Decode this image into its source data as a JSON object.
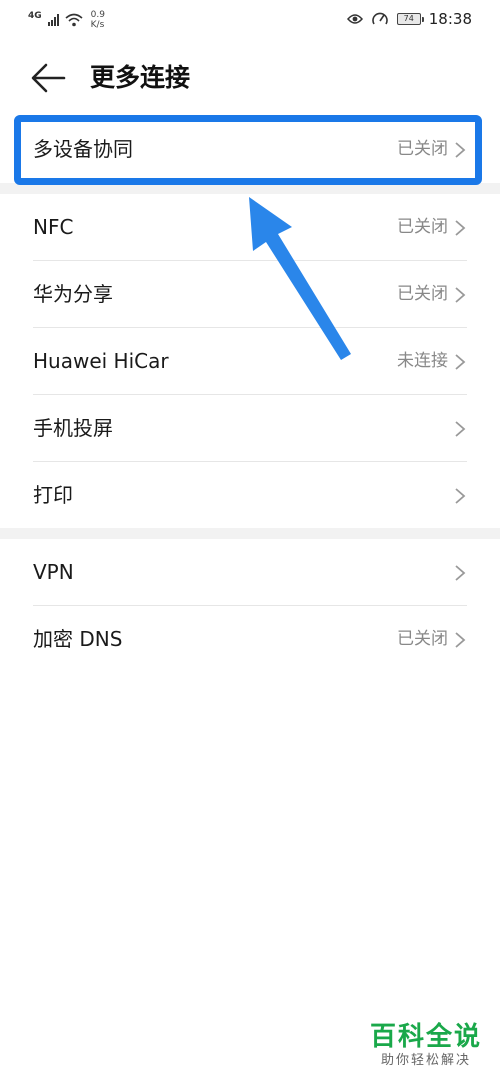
{
  "status_bar": {
    "network": "4G",
    "speed_value": "0.9",
    "speed_unit": "K/s",
    "battery": "74",
    "time": "18:38",
    "icons": [
      "wifi-icon",
      "eye-icon",
      "speedometer-icon"
    ]
  },
  "header": {
    "title": "更多连接",
    "back_icon": "arrow-left-icon"
  },
  "groups": [
    {
      "items": [
        {
          "label": "多设备协同",
          "status": "已关闭"
        }
      ]
    },
    {
      "items": [
        {
          "label": "NFC",
          "status": "已关闭"
        },
        {
          "label": "华为分享",
          "status": "已关闭"
        },
        {
          "label": "Huawei HiCar",
          "status": "未连接"
        },
        {
          "label": "手机投屏",
          "status": ""
        },
        {
          "label": "打印",
          "status": ""
        }
      ]
    },
    {
      "items": [
        {
          "label": "VPN",
          "status": ""
        },
        {
          "label": "加密 DNS",
          "status": "已关闭"
        }
      ]
    }
  ],
  "annotation": {
    "highlight_color": "#1a78e8",
    "arrow_color": "#2a86ea"
  },
  "watermark": {
    "title": "百科全说",
    "subtitle": "助你轻松解决",
    "color": "#1aa84a"
  }
}
